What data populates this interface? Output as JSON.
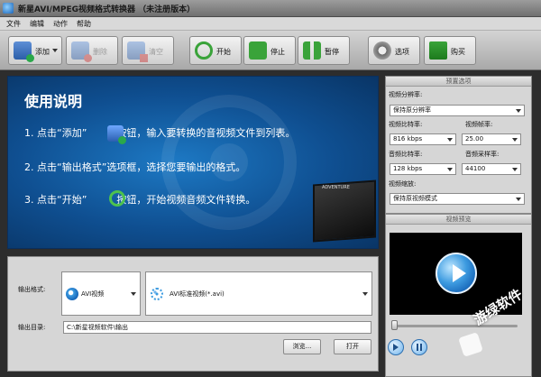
{
  "window": {
    "title": "新星AVI/MPEG视频格式转换器 （未注册版本）"
  },
  "menu": [
    "文件",
    "编辑",
    "动作",
    "帮助"
  ],
  "toolbar": {
    "add": "添加",
    "delete": "删除",
    "clear": "清空",
    "start": "开始",
    "stop": "停止",
    "pause": "暂停",
    "options": "选项",
    "buy": "购买"
  },
  "banner": {
    "title": "使用说明",
    "step1_a": "1. 点击“添加”",
    "step1_b": "按钮，输入要转换的音视频文件到列表。",
    "step2": "2. 点击“输出格式”选项框，选择您要输出的格式。",
    "step3_a": "3. 点击“开始”",
    "step3_b": "按钮，开始视频音频文件转换。",
    "poster_label": "ADVENTURE"
  },
  "presets": {
    "header": "预置选项",
    "resolution_label": "视频分辨率:",
    "resolution_value": "保持原分辨率",
    "video_bitrate_label": "视频比特率:",
    "video_bitrate_value": "816 kbps",
    "frame_rate_label": "视频帧率:",
    "frame_rate_value": "25.00",
    "audio_bitrate_label": "音频比特率:",
    "audio_bitrate_value": "128 kbps",
    "sample_rate_label": "音频采样率:",
    "sample_rate_value": "44100",
    "scale_label": "视频缩放:",
    "scale_value": "保持原视频模式"
  },
  "preview": {
    "header": "视频预览",
    "position": 0
  },
  "output": {
    "format_label": "输出格式:",
    "format_category": "AVI视频",
    "format_profile": "AVI标准视频(*.avi)",
    "dir_label": "输出目录:",
    "dir_value": "C:\\新星视频软件\\输出",
    "browse": "浏览...",
    "open": "打开"
  },
  "watermark": {
    "text": "游绿软件"
  }
}
